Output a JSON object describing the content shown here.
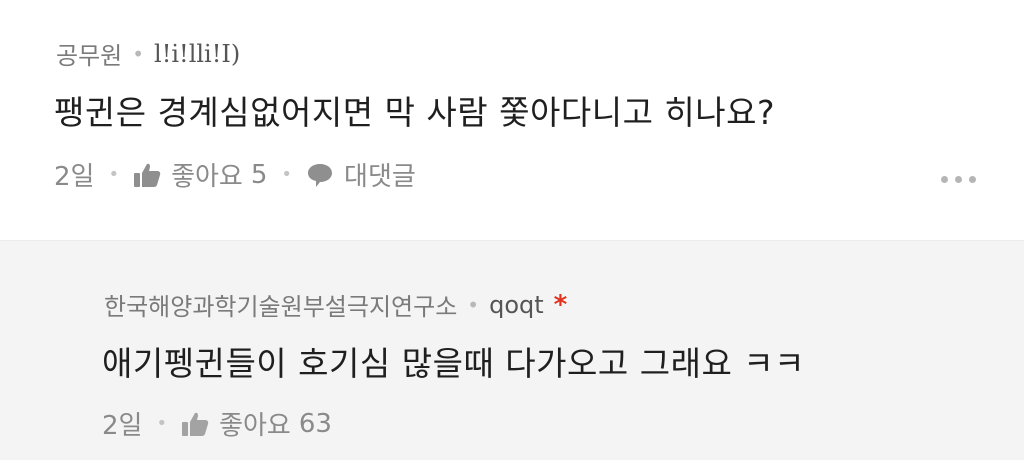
{
  "comments": [
    {
      "author": "공무원",
      "nickname": "l!i!lli!I)",
      "text": "팽귄은 경계심없어지면 막 사람 쫓아다니고 히나요?",
      "time": "2일",
      "like_label": "좋아요",
      "like_count": "5",
      "reply_label": "대댓글"
    },
    {
      "author": "한국해양과학기술원부설극지연구소",
      "nickname": "qoqt",
      "badge": "*",
      "text": "애기펭귄들이 호기심 많을때 다가오고 그래요 ㅋㅋ",
      "time": "2일",
      "like_label": "좋아요",
      "like_count": "63"
    }
  ],
  "icons": {
    "like": "thumbs-up-icon",
    "reply": "speech-bubble-icon",
    "more": "more-dots-icon"
  },
  "colors": {
    "badge": "#e0331f",
    "reply_background": "#f4f4f4"
  }
}
